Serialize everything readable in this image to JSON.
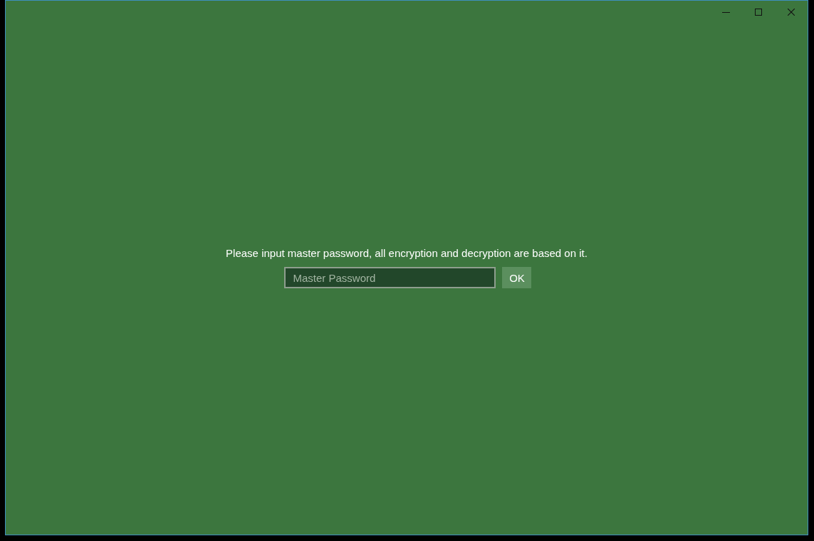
{
  "prompt": {
    "message": "Please input master password, all encryption and decryption are based on it.",
    "password_field": {
      "placeholder": "Master Password"
    },
    "ok_button": {
      "label": "OK"
    }
  }
}
